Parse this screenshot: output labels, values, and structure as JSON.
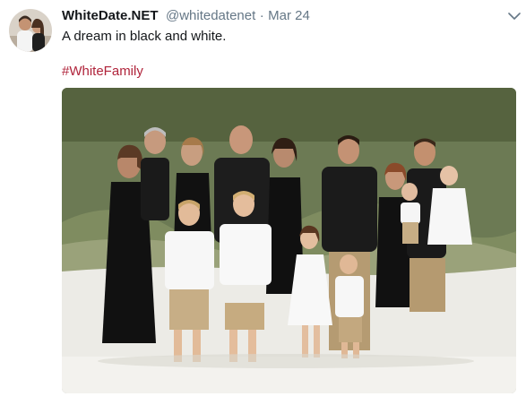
{
  "tweet": {
    "display_name": "WhiteDate.NET",
    "handle": "@whitedatenet",
    "separator": "·",
    "timestamp": "Mar 24",
    "text": "A dream in black and white.",
    "hashtag": "#WhiteFamily"
  },
  "icons": {
    "menu": "chevron-down-icon"
  },
  "colors": {
    "link": "#b0243b",
    "secondary_text": "#657786",
    "primary_text": "#14171a"
  }
}
